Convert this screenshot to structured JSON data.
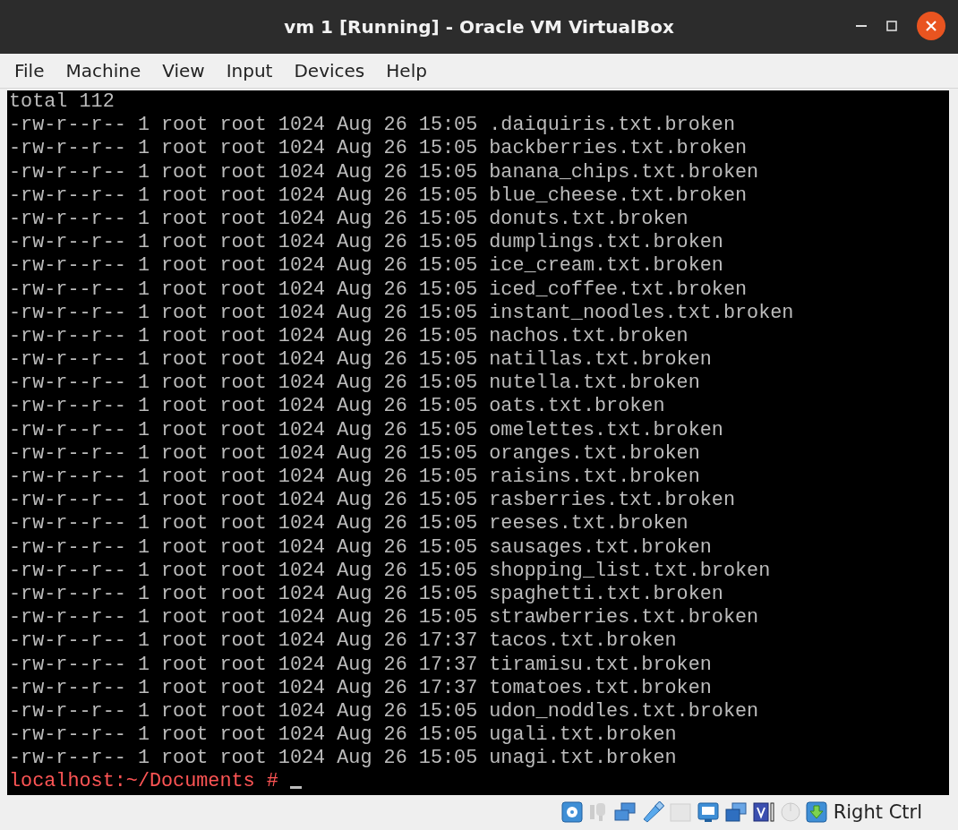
{
  "window": {
    "title": "vm 1 [Running] - Oracle VM VirtualBox"
  },
  "menu": [
    "File",
    "Machine",
    "View",
    "Input",
    "Devices",
    "Help"
  ],
  "terminal": {
    "lines": [
      "total 112",
      "-rw-r--r-- 1 root root 1024 Aug 26 15:05 .daiquiris.txt.broken",
      "-rw-r--r-- 1 root root 1024 Aug 26 15:05 backberries.txt.broken",
      "-rw-r--r-- 1 root root 1024 Aug 26 15:05 banana_chips.txt.broken",
      "-rw-r--r-- 1 root root 1024 Aug 26 15:05 blue_cheese.txt.broken",
      "-rw-r--r-- 1 root root 1024 Aug 26 15:05 donuts.txt.broken",
      "-rw-r--r-- 1 root root 1024 Aug 26 15:05 dumplings.txt.broken",
      "-rw-r--r-- 1 root root 1024 Aug 26 15:05 ice_cream.txt.broken",
      "-rw-r--r-- 1 root root 1024 Aug 26 15:05 iced_coffee.txt.broken",
      "-rw-r--r-- 1 root root 1024 Aug 26 15:05 instant_noodles.txt.broken",
      "-rw-r--r-- 1 root root 1024 Aug 26 15:05 nachos.txt.broken",
      "-rw-r--r-- 1 root root 1024 Aug 26 15:05 natillas.txt.broken",
      "-rw-r--r-- 1 root root 1024 Aug 26 15:05 nutella.txt.broken",
      "-rw-r--r-- 1 root root 1024 Aug 26 15:05 oats.txt.broken",
      "-rw-r--r-- 1 root root 1024 Aug 26 15:05 omelettes.txt.broken",
      "-rw-r--r-- 1 root root 1024 Aug 26 15:05 oranges.txt.broken",
      "-rw-r--r-- 1 root root 1024 Aug 26 15:05 raisins.txt.broken",
      "-rw-r--r-- 1 root root 1024 Aug 26 15:05 rasberries.txt.broken",
      "-rw-r--r-- 1 root root 1024 Aug 26 15:05 reeses.txt.broken",
      "-rw-r--r-- 1 root root 1024 Aug 26 15:05 sausages.txt.broken",
      "-rw-r--r-- 1 root root 1024 Aug 26 15:05 shopping_list.txt.broken",
      "-rw-r--r-- 1 root root 1024 Aug 26 15:05 spaghetti.txt.broken",
      "-rw-r--r-- 1 root root 1024 Aug 26 15:05 strawberries.txt.broken",
      "-rw-r--r-- 1 root root 1024 Aug 26 17:37 tacos.txt.broken",
      "-rw-r--r-- 1 root root 1024 Aug 26 17:37 tiramisu.txt.broken",
      "-rw-r--r-- 1 root root 1024 Aug 26 17:37 tomatoes.txt.broken",
      "-rw-r--r-- 1 root root 1024 Aug 26 15:05 udon_noddles.txt.broken",
      "-rw-r--r-- 1 root root 1024 Aug 26 15:05 ugali.txt.broken",
      "-rw-r--r-- 1 root root 1024 Aug 26 15:05 unagi.txt.broken"
    ],
    "prompt": "localhost:~/Documents #"
  },
  "status_bar": {
    "host_key": "Right Ctrl"
  }
}
